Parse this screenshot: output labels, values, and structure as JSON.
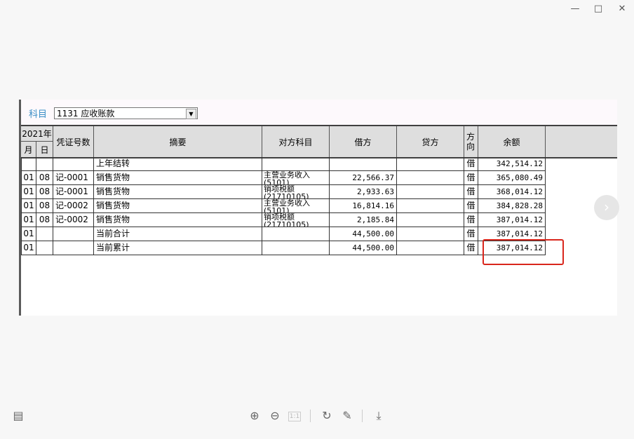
{
  "window": {
    "minimize_icon": "minimize-icon",
    "maximize_icon": "maximize-icon",
    "close_icon": "close-icon"
  },
  "subject": {
    "label": "科目",
    "value": "1131 应收账款"
  },
  "table": {
    "header": {
      "year": "2021年",
      "month": "月",
      "day": "日",
      "voucher": "凭证号数",
      "summary": "摘要",
      "counter_account": "对方科目",
      "debit": "借方",
      "credit": "贷方",
      "direction": "方向",
      "balance": "余额"
    },
    "rows": [
      {
        "month": "",
        "day": "",
        "voucher": "",
        "summary": "上年结转",
        "counter": "",
        "debit": "",
        "credit": "",
        "direction": "借",
        "balance": "342,514.12"
      },
      {
        "month": "01",
        "day": "08",
        "voucher": "记-0001",
        "summary": "销售货物",
        "counter": "主营业务收入(5101)",
        "debit": "22,566.37",
        "credit": "",
        "direction": "借",
        "balance": "365,080.49"
      },
      {
        "month": "01",
        "day": "08",
        "voucher": "记-0001",
        "summary": "销售货物",
        "counter": "销项税额(21710105)",
        "debit": "2,933.63",
        "credit": "",
        "direction": "借",
        "balance": "368,014.12"
      },
      {
        "month": "01",
        "day": "08",
        "voucher": "记-0002",
        "summary": "销售货物",
        "counter": "主营业务收入(5101)",
        "debit": "16,814.16",
        "credit": "",
        "direction": "借",
        "balance": "384,828.28"
      },
      {
        "month": "01",
        "day": "08",
        "voucher": "记-0002",
        "summary": "销售货物",
        "counter": "销项税额(21710105)",
        "debit": "2,185.84",
        "credit": "",
        "direction": "借",
        "balance": "387,014.12"
      },
      {
        "month": "01",
        "day": "",
        "voucher": "",
        "summary": "当前合计",
        "counter": "",
        "debit": "44,500.00",
        "credit": "",
        "direction": "借",
        "balance": "387,014.12"
      },
      {
        "month": "01",
        "day": "",
        "voucher": "",
        "summary": "当前累计",
        "counter": "",
        "debit": "44,500.00",
        "credit": "",
        "direction": "借",
        "balance": "387,014.12"
      }
    ]
  },
  "viewer": {
    "next_icon": "chevron-right-icon",
    "ratio_label": "1:1"
  }
}
